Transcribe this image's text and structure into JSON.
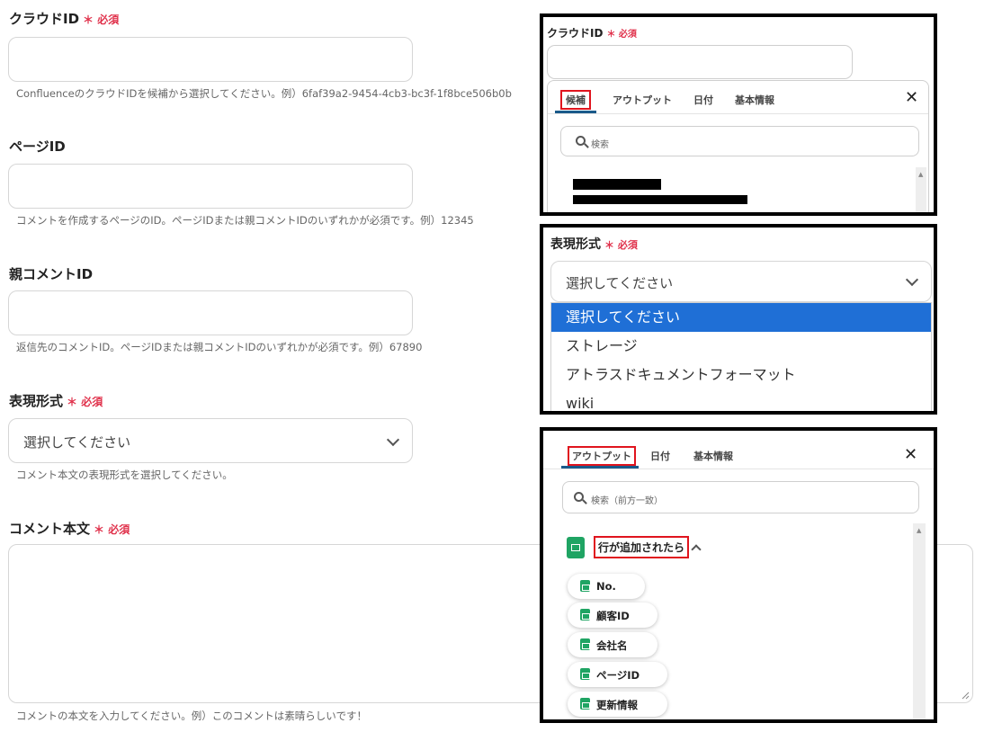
{
  "form": {
    "cloud_id": {
      "label": "クラウドID",
      "required": "＊ 必須",
      "help": "ConfluenceのクラウドIDを候補から選択してください。例）6faf39a2-9454-4cb3-bc3f-1f8bce506b0b"
    },
    "page_id": {
      "label": "ページID",
      "help": "コメントを作成するページのID。ページIDまたは親コメントIDのいずれかが必須です。例）12345"
    },
    "parent_comment_id": {
      "label": "親コメントID",
      "help": "返信先のコメントID。ページIDまたは親コメントIDのいずれかが必須です。例）67890"
    },
    "format": {
      "label": "表現形式",
      "required": "＊ 必須",
      "value": "選択してください",
      "help": "コメント本文の表現形式を選択してください。"
    },
    "body": {
      "label": "コメント本文",
      "required": "＊ 必須",
      "help": "コメントの本文を入力してください。例）このコメントは素晴らしいです！"
    }
  },
  "panel1": {
    "label": "クラウドID",
    "required": "＊ 必須",
    "tabs": [
      "候補",
      "アウトプット",
      "日付",
      "基本情報"
    ],
    "close": "✕",
    "search_placeholder": "検索"
  },
  "panel2": {
    "label": "表現形式",
    "required": "＊ 必須",
    "value": "選択してください",
    "options": [
      "選択してください",
      "ストレージ",
      "アトラスドキュメントフォーマット",
      "wiki"
    ]
  },
  "panel3": {
    "tabs": [
      "アウトプット",
      "日付",
      "基本情報"
    ],
    "close": "✕",
    "search_placeholder": "検索（前方一致）",
    "group": "行が追加されたら",
    "items": [
      "No.",
      "顧客ID",
      "会社名",
      "ページID",
      "更新情報"
    ]
  },
  "colors": {
    "required": "#e0314b",
    "selected": "#1f6fd6",
    "highlight": "#e0141e",
    "sheets": "#1fa463"
  }
}
